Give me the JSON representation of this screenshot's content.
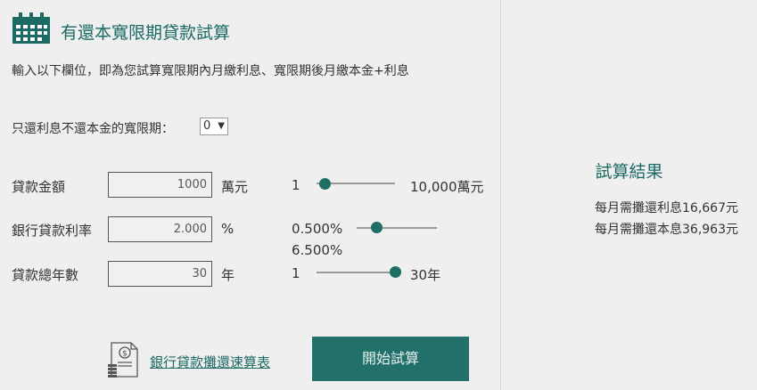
{
  "header": {
    "title": "有還本寬限期貸款試算",
    "description": "輸入以下欄位，即為您試算寬限期內月繳利息、寬限期後月繳本金+利息"
  },
  "grace_period": {
    "label": "只還利息不還本金的寬限期：",
    "selected": "0"
  },
  "loan_amount": {
    "label": "貸款金額",
    "value": "1000",
    "unit": "萬元",
    "min_label": "1",
    "max_label": "10,000萬元",
    "slider_fraction": 0.1
  },
  "interest_rate": {
    "label": "銀行貸款利率",
    "value": "2.000",
    "unit": "%",
    "min_label": "0.500%",
    "max_label": "6.500%",
    "slider_fraction": 0.25
  },
  "loan_years": {
    "label": "貸款總年數",
    "value": "30",
    "unit": "年",
    "min_label": "1",
    "max_label": "30年",
    "slider_fraction": 1.0
  },
  "footer": {
    "link_label": "銀行貸款攤還速算表",
    "link_icon": "money-document-icon",
    "button_label": "開始試算"
  },
  "result": {
    "title": "試算結果",
    "monthly_interest": "每月需攤還利息16,667元",
    "monthly_principal_interest": "每月需攤還本息36,963元"
  },
  "colors": {
    "accent": "#1b6a63",
    "button": "#22706a",
    "background": "#efefef"
  }
}
